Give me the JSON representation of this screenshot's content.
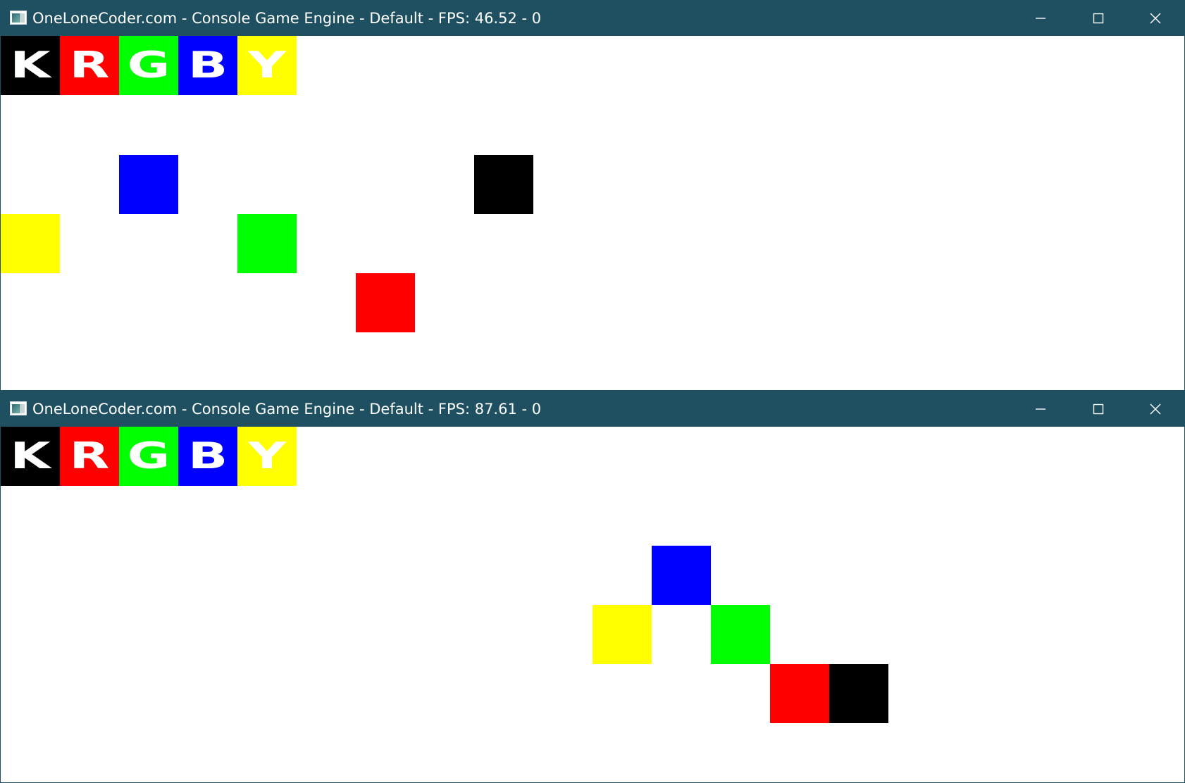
{
  "colors": {
    "K": "#000000",
    "R": "#ff0000",
    "G": "#00ff00",
    "B": "#0000ff",
    "Y": "#ffff00",
    "titlebar": "#1e5062"
  },
  "windows": [
    {
      "title": "OneLoneCoder.com - Console Game Engine - Default - FPS: 46.52 - 0",
      "icon": "console-app-icon",
      "controls": [
        "minimize-icon",
        "maximize-icon",
        "close-icon"
      ],
      "palette_letters": [
        "K",
        "R",
        "G",
        "B",
        "Y"
      ],
      "grid_cell_units": "20 px console cells (84 px on screen)"
    },
    {
      "title": "OneLoneCoder.com - Console Game Engine - Default - FPS: 87.61 - 0",
      "icon": "console-app-icon",
      "controls": [
        "minimize-icon",
        "maximize-icon",
        "close-icon"
      ],
      "palette_letters": [
        "K",
        "R",
        "G",
        "B",
        "Y"
      ]
    }
  ]
}
